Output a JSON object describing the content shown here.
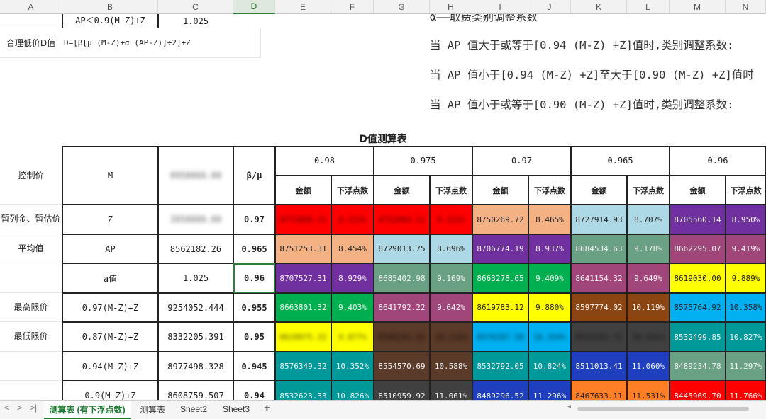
{
  "columns": [
    "A",
    "B",
    "C",
    "D",
    "E",
    "F",
    "G",
    "H",
    "I",
    "J",
    "K",
    "L",
    "M",
    "N"
  ],
  "selected_column": "D",
  "top": {
    "row0": {
      "b": "AP＜0.9(M-Z)+Z",
      "c": "1.025"
    },
    "row1": {
      "a": "合理低价D值",
      "b": "D=[β[μ (M-Z)+α (AP-Z)]÷2]+Z"
    },
    "notes": [
      "α——取费类别调整系数",
      "当 AP 值大于或等于[0.94 (M-Z) +Z]值时,类别调整系数:",
      "当 AP 值小于[0.94 (M-Z) +Z]至大于[0.90 (M-Z) +Z]值时",
      "当 AP 值小于或等于[0.90 (M-Z) +Z]值时,类别调整系数:"
    ]
  },
  "table": {
    "title": "D值测算表",
    "headers": {
      "control": "控制价",
      "m": "M",
      "m_value": "8950060.00",
      "beta_mu": "β/μ",
      "groups": [
        "0.98",
        "0.975",
        "0.97",
        "0.965",
        "0.96"
      ],
      "sub_amount": "金额",
      "sub_float": "下浮点数"
    },
    "rows": [
      {
        "a": "暂列金、暂估价",
        "b": "Z",
        "c": "3950000.00",
        "d": "0.97",
        "cells": [
          [
            "8773000.31",
            "8.223%"
          ],
          [
            "8752004.51",
            "8.322%"
          ],
          [
            "8750269.72",
            "8.465%"
          ],
          [
            "8727914.93",
            "8.707%"
          ],
          [
            "8705560.14",
            "8.950%"
          ]
        ]
      },
      {
        "a": "平均值",
        "b": "AP",
        "c": "8562182.26",
        "d": "0.965",
        "cells": [
          [
            "8751253.31",
            "8.454%"
          ],
          [
            "8729013.75",
            "8.696%"
          ],
          [
            "8706774.19",
            "8.937%"
          ],
          [
            "8684534.63",
            "9.178%"
          ],
          [
            "8662295.07",
            "9.419%"
          ]
        ]
      },
      {
        "a": "",
        "b": "a值",
        "c": "1.025",
        "d": "0.96",
        "cells": [
          [
            "8707527.31",
            "8.929%"
          ],
          [
            "8685402.98",
            "9.169%"
          ],
          [
            "8663278.65",
            "9.409%"
          ],
          [
            "8641154.32",
            "9.649%"
          ],
          [
            "8619030.00",
            "9.889%"
          ]
        ]
      },
      {
        "a": "最高限价",
        "b": "0.97(M-Z)+Z",
        "c": "9254052.444",
        "d": "0.955",
        "cells": [
          [
            "8663801.32",
            "9.403%"
          ],
          [
            "8641792.22",
            "9.642%"
          ],
          [
            "8619783.12",
            "9.880%"
          ],
          [
            "8597774.02",
            "10.119%"
          ],
          [
            "8575764.92",
            "10.358%"
          ]
        ]
      },
      {
        "a": "最低限价",
        "b": "0.87(M-Z)+Z",
        "c": "8332205.391",
        "d": "0.95",
        "cells": [
          [
            "8620075.32",
            "9.877%"
          ],
          [
            "8598181.45",
            "10.116%"
          ],
          [
            "8576287.58",
            "10.354%"
          ],
          [
            "8554393.71",
            "10.591%"
          ],
          [
            "8532499.85",
            "10.827%"
          ]
        ]
      },
      {
        "a": "",
        "b": "0.94(M-Z)+Z",
        "c": "8977498.328",
        "d": "0.945",
        "cells": [
          [
            "8576349.32",
            "10.352%"
          ],
          [
            "8554570.69",
            "10.588%"
          ],
          [
            "8532792.05",
            "10.824%"
          ],
          [
            "8511013.41",
            "11.060%"
          ],
          [
            "8489234.78",
            "11.297%"
          ]
        ]
      },
      {
        "a": "",
        "b": "0.9(M-Z)+Z",
        "c": "8608759.507",
        "d": "0.94",
        "cells": [
          [
            "8532623.33",
            "10.826%"
          ],
          [
            "8510959.92",
            "11.061%"
          ],
          [
            "8489296.52",
            "11.296%"
          ],
          [
            "8467633.11",
            "11.531%"
          ],
          [
            "8445969.70",
            "11.766%"
          ]
        ]
      }
    ]
  },
  "cell_colors": [
    [
      "#ff0000",
      "#ff0000",
      "#f4b183",
      "#add8e6",
      "#7030a0"
    ],
    [
      "#f4b183",
      "#add8e6",
      "#7030a0",
      "#6aa084",
      "#a0467a"
    ],
    [
      "#7030a0",
      "#6aa084",
      "#00b050",
      "#a0467a",
      "#ffff00"
    ],
    [
      "#00b050",
      "#a0467a",
      "#ffff00",
      "#8b4513",
      "#00b0f0"
    ],
    [
      "#ffff00",
      "#5a3a28",
      "#00b0f0",
      "#404040",
      "#009999"
    ],
    [
      "#009999",
      "#5a3a28",
      "#009999",
      "#1f3fbf",
      "#6aa084"
    ],
    [
      "#009999",
      "#404040",
      "#1f3fbf",
      "#ff7f27",
      "#ff0000"
    ]
  ],
  "blurred_cells": [
    [
      0,
      0
    ],
    [
      0,
      1
    ],
    [
      4,
      0
    ],
    [
      4,
      1
    ],
    [
      4,
      2
    ],
    [
      4,
      3
    ]
  ],
  "sheet_tabs": [
    "测算表 (有下浮点数)",
    "测算表",
    "Sheet2",
    "Sheet3"
  ],
  "active_tab": 0,
  "nav": {
    "first": "‹",
    "prev": "›",
    "last": "›|",
    "add": "+"
  }
}
